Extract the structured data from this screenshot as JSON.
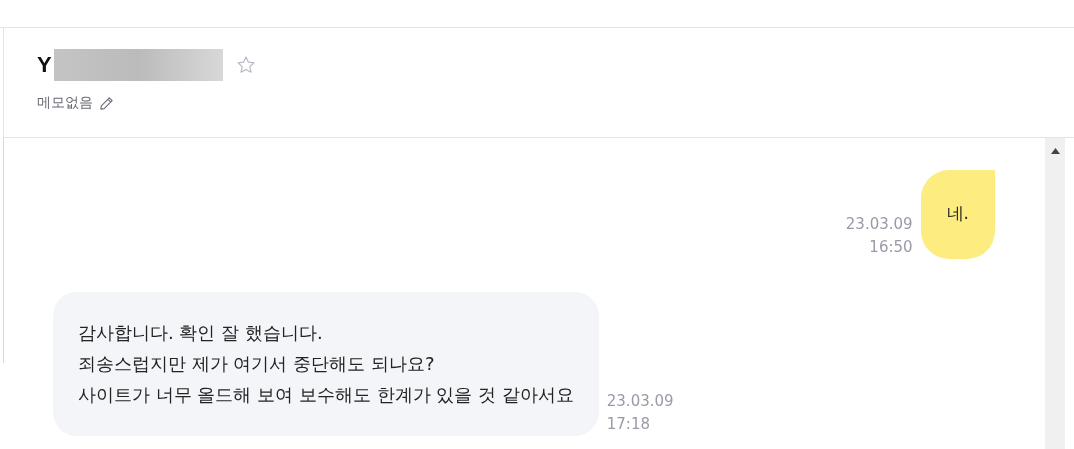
{
  "contact": {
    "name": "Y",
    "starred": false,
    "memo": "메모없음"
  },
  "messages": [
    {
      "kind": "sent",
      "lines": [
        "네."
      ],
      "date": "23.03.09",
      "time": "16:50"
    },
    {
      "kind": "received",
      "lines": [
        "감사합니다. 확인 잘 했습니다.",
        "죄송스럽지만 제가 여기서 중단해도 되나요?",
        "사이트가 너무 올드해 보여 보수해도 한계가 있을 것 같아서요"
      ],
      "date": "23.03.09",
      "time": "17:18"
    }
  ]
}
